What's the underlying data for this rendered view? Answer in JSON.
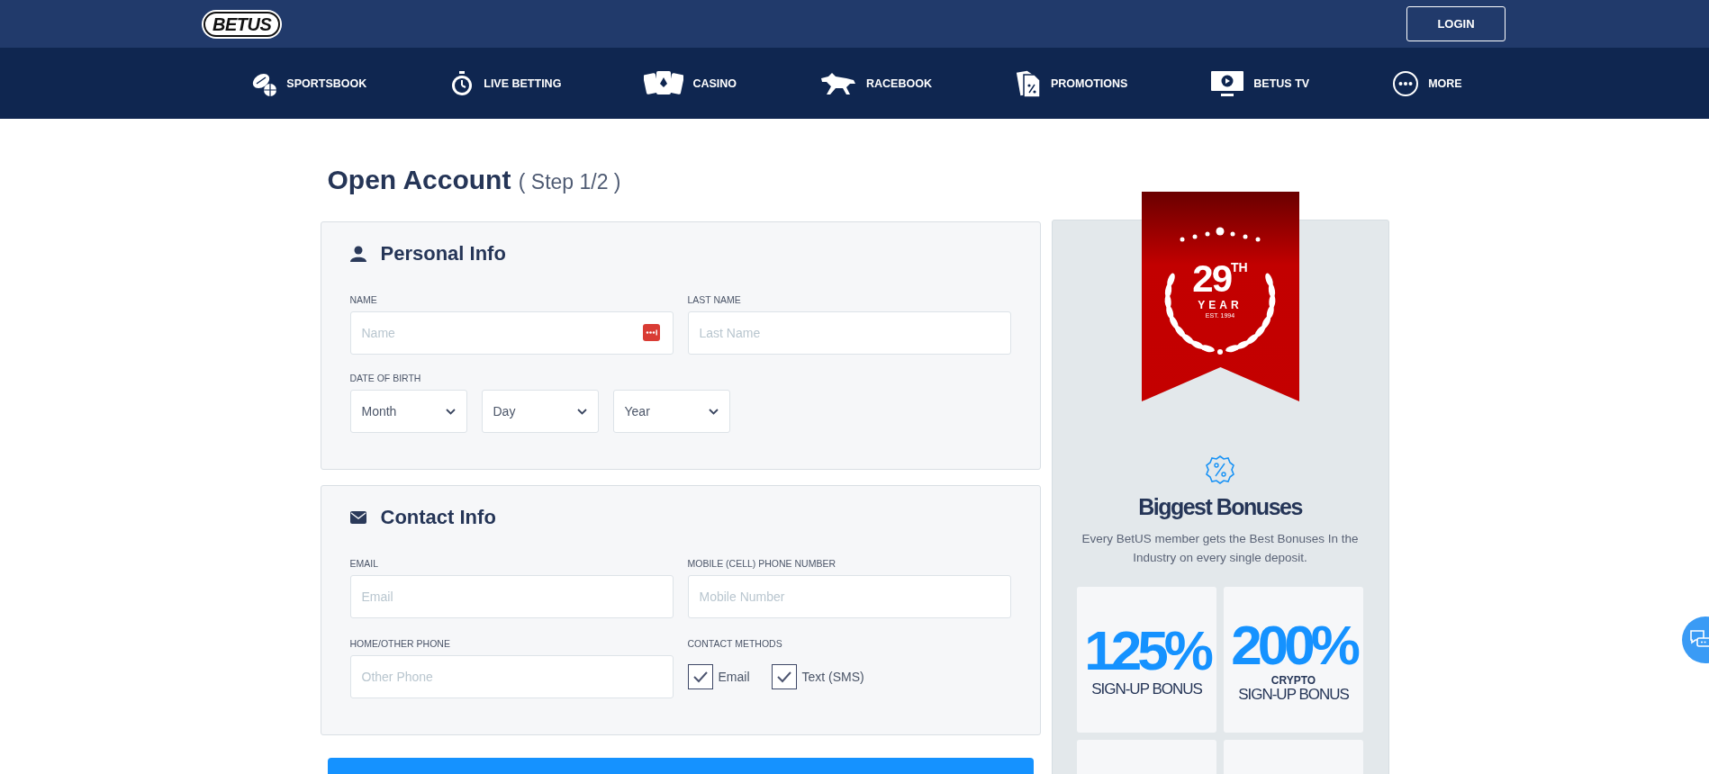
{
  "header": {
    "logo": "BETUS",
    "login_button": "LOGIN"
  },
  "nav": [
    {
      "label": "SPORTSBOOK",
      "kind": "sports"
    },
    {
      "label": "LIVE BETTING",
      "kind": "stopwatch"
    },
    {
      "label": "CASINO",
      "kind": "cards"
    },
    {
      "label": "RACEBOOK",
      "kind": "horse"
    },
    {
      "label": "PROMOTIONS",
      "kind": "tag"
    },
    {
      "label": "BETUS TV",
      "kind": "tv"
    },
    {
      "label": "MORE",
      "kind": "more"
    }
  ],
  "page_title": "Open Account",
  "step": "( Step 1/2 )",
  "personal_info": {
    "heading": "Personal Info",
    "name_label": "NAME",
    "name_placeholder": "Name",
    "last_name_label": "LAST NAME",
    "last_name_placeholder": "Last Name",
    "dob_label": "DATE OF BIRTH",
    "dob_selects": [
      "Month",
      "Day",
      "Year"
    ]
  },
  "contact_info": {
    "heading": "Contact Info",
    "email_label": "EMAIL",
    "email_placeholder": "Email",
    "mobile_label": "MOBILE (CELL) PHONE NUMBER",
    "mobile_placeholder": "Mobile Number",
    "other_label": "HOME/OTHER PHONE",
    "other_placeholder": "Other Phone",
    "methods_label": "CONTACT METHODS",
    "methods": [
      {
        "label": "Email",
        "checked": true
      },
      {
        "label": "Text (SMS)",
        "checked": true
      }
    ]
  },
  "promo": {
    "ribbon": {
      "number": "29",
      "suffix": "TH",
      "label": "YEAR",
      "est": "EST. 1994"
    },
    "heading": "Biggest Bonuses",
    "description": "Every BetUS member gets the Best Bonuses In the Industry on every single deposit.",
    "tiles": [
      {
        "value": "125%",
        "caption": "SIGN-UP BONUS"
      },
      {
        "value": "200%",
        "small": "CRYPTO",
        "caption": "SIGN-UP BONUS"
      }
    ]
  }
}
